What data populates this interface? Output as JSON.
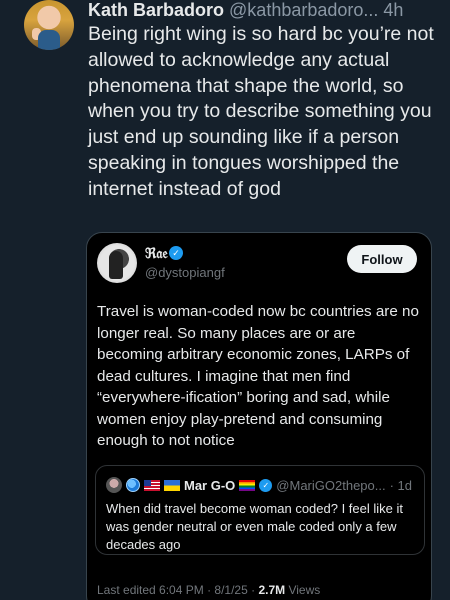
{
  "post": {
    "author_name": "Kath Barbadoro",
    "author_handle": "@kathbarbadoro...",
    "time": "4h",
    "text": "Being right wing is so hard bc you’re not allowed to acknowledge any actual phenomena that shape the world, so when you try to describe something you just end up sounding like if a person speaking in tongues worshipped the internet instead of god"
  },
  "quote": {
    "author_name": "ℜ𝔞𝔢",
    "author_handle": "@dystopiangf",
    "follow_label": "Follow",
    "text": "Travel is woman-coded now bc countries are no longer real. So many places are or are becoming arbitrary economic zones, LARPs of dead cultures. I imagine that men find “everywhere-ification” boring and sad, while women enjoy play-pretend and consuming enough to not notice",
    "meta": {
      "edited": "Last edited 6:04 PM · 8/1/25 ·",
      "views": "2.7M",
      "views_label": "Views"
    }
  },
  "nested_quote": {
    "author_name": "Mar G-O",
    "author_handle": "@MariGO2thepo...",
    "time": "· 1d",
    "text": "When did travel become woman coded? I feel like it was gender neutral or even male coded only a few decades ago"
  },
  "colors": {
    "background": "#15202b",
    "card_background": "#000000",
    "verified": "#1d9bf0",
    "secondary_text": "#8b98a5"
  }
}
